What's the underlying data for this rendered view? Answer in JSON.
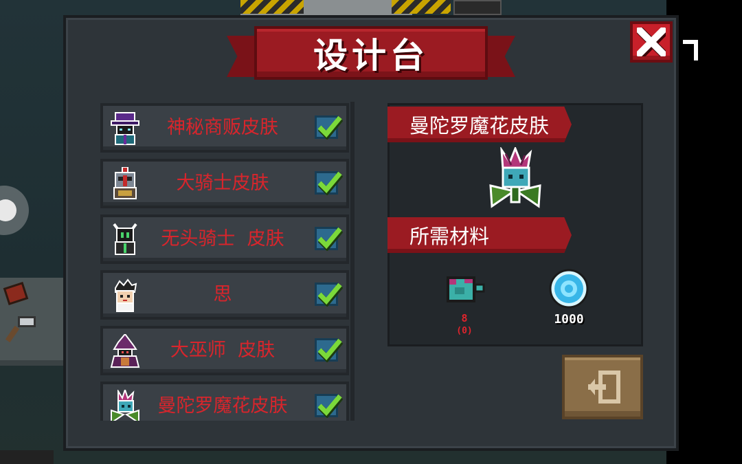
{
  "panel": {
    "title": "设计台"
  },
  "skins": [
    {
      "label": "神秘商贩皮肤",
      "avatar": "merchant-avatar-icon",
      "checked": true
    },
    {
      "label": "大骑士皮肤",
      "avatar": "grand-knight-avatar-icon",
      "checked": true
    },
    {
      "label": "无头骑士  皮肤",
      "avatar": "headless-knight-avatar-icon",
      "checked": true
    },
    {
      "label": "思",
      "avatar": "si-avatar-icon",
      "checked": true
    },
    {
      "label": "大巫师  皮肤",
      "avatar": "archmage-avatar-icon",
      "checked": true
    },
    {
      "label": "曼陀罗魔花皮肤",
      "avatar": "mandrake-avatar-icon",
      "checked": true
    }
  ],
  "detail": {
    "skin_name": "曼陀罗魔花皮肤",
    "materials_title": "所需材料",
    "materials": [
      {
        "icon": "part-material-icon",
        "required": "8",
        "owned": "(0)"
      },
      {
        "icon": "gem-coin-icon",
        "amount": "1000"
      }
    ]
  },
  "colors": {
    "accent_red": "#9b1b22",
    "label_red": "#d8252c",
    "check_green": "#7bd93a",
    "panel_bg": "#2e3439"
  }
}
